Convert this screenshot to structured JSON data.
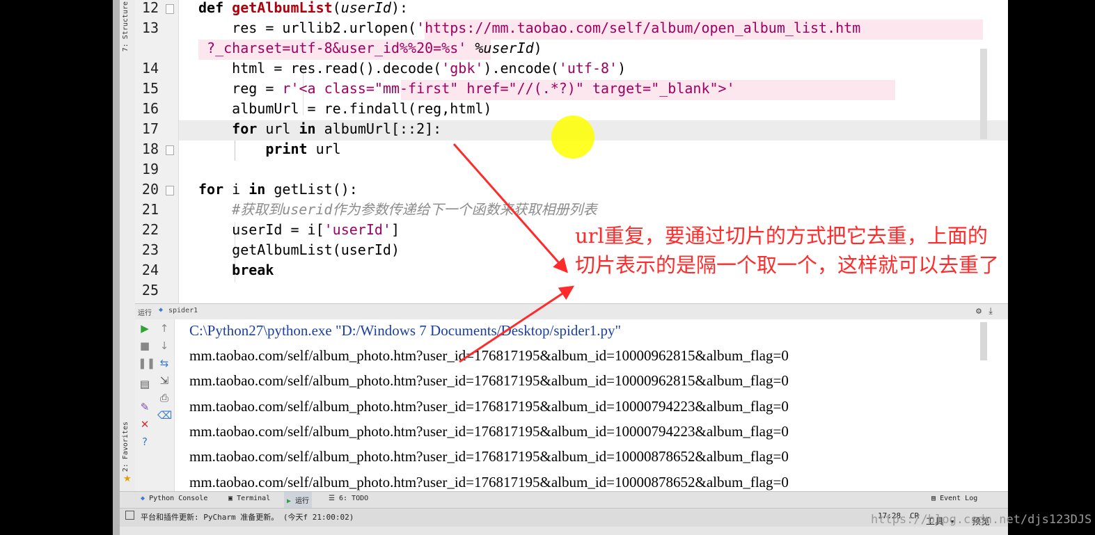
{
  "editor": {
    "lines": [
      {
        "n": "12",
        "parts": [
          {
            "t": "def ",
            "c": "kwb"
          },
          {
            "t": "getAlbumList",
            "c": "fn"
          },
          {
            "t": "("
          },
          {
            "t": "userId",
            "c": "param"
          },
          {
            "t": "):"
          }
        ]
      },
      {
        "n": "13",
        "parts": [
          {
            "t": "    res = urllib2.urlopen("
          },
          {
            "t": "'https://mm.taobao.com/self/album/open_album_list.htm",
            "c": "str"
          }
        ]
      },
      {
        "n": "",
        "parts": [
          {
            "t": " ?_charset=utf-8&user_id%%20=%s'",
            "c": "str"
          },
          {
            "t": " %"
          },
          {
            "t": "userId",
            "c": "param"
          },
          {
            "t": ")"
          }
        ]
      },
      {
        "n": "14",
        "parts": [
          {
            "t": "    html = res.read().decode("
          },
          {
            "t": "'gbk'",
            "c": "str"
          },
          {
            "t": ").encode("
          },
          {
            "t": "'utf-8'",
            "c": "str"
          },
          {
            "t": ")"
          }
        ]
      },
      {
        "n": "15",
        "parts": [
          {
            "t": "    reg = "
          },
          {
            "t": "r'<a class=\"mm-first\" href=\"//(.*?)\" target=\"_blank\">'",
            "c": "str"
          }
        ]
      },
      {
        "n": "16",
        "parts": [
          {
            "t": "    albumUrl = re.findall(reg,html)"
          }
        ]
      },
      {
        "n": "17",
        "parts": [
          {
            "t": "    "
          },
          {
            "t": "for",
            "c": "kwb"
          },
          {
            "t": " url "
          },
          {
            "t": "in",
            "c": "kwb"
          },
          {
            "t": " albumUrl[::2]:"
          }
        ]
      },
      {
        "n": "18",
        "parts": [
          {
            "t": "        "
          },
          {
            "t": "print",
            "c": "kwb"
          },
          {
            "t": " url"
          }
        ]
      },
      {
        "n": "19",
        "parts": []
      },
      {
        "n": "20",
        "parts": [
          {
            "t": "for",
            "c": "kwb"
          },
          {
            "t": " i "
          },
          {
            "t": "in",
            "c": "kwb"
          },
          {
            "t": " getList():"
          }
        ]
      },
      {
        "n": "21",
        "parts": [
          {
            "t": "    #获取到userid作为参数传递给下一个函数来获取相册列表",
            "c": "cmt"
          }
        ]
      },
      {
        "n": "22",
        "parts": [
          {
            "t": "    userId = i["
          },
          {
            "t": "'userId'",
            "c": "str"
          },
          {
            "t": "]"
          }
        ]
      },
      {
        "n": "23",
        "parts": [
          {
            "t": "    getAlbumList(userId)"
          }
        ]
      },
      {
        "n": "24",
        "parts": [
          {
            "t": "    "
          },
          {
            "t": "break",
            "c": "kwb"
          }
        ]
      },
      {
        "n": "25",
        "parts": []
      }
    ]
  },
  "toolwindow_tabs": {
    "structure": "7: Structure",
    "favorites": "2: Favorites"
  },
  "run": {
    "header_label": "运行",
    "config_name": "spider1",
    "command": "C:\\Python27\\python.exe \"D:/Windows 7 Documents/Desktop/spider1.py\"",
    "output": [
      "mm.taobao.com/self/album_photo.htm?user_id=176817195&album_id=10000962815&album_flag=0",
      "mm.taobao.com/self/album_photo.htm?user_id=176817195&album_id=10000962815&album_flag=0",
      "mm.taobao.com/self/album_photo.htm?user_id=176817195&album_id=10000794223&album_flag=0",
      "mm.taobao.com/self/album_photo.htm?user_id=176817195&album_id=10000794223&album_flag=0",
      "mm.taobao.com/self/album_photo.htm?user_id=176817195&album_id=10000878652&album_flag=0",
      "mm.taobao.com/self/album_photo.htm?user_id=176817195&album_id=10000878652&album_flag=0"
    ]
  },
  "bottom_tabs": {
    "python_console": "Python Console",
    "terminal": "Terminal",
    "run": "运行",
    "todo": "6: TODO",
    "event_log": "Event Log"
  },
  "status": {
    "message": "平台和插件更新: PyCharm 准备更新。 (今天f 21:00:02)",
    "position": "17:28",
    "crlf": "CR",
    "tools": "工具",
    "preview": "预览"
  },
  "annotation": {
    "line1": "url重复，要通过切片的方式把它去重，上面的",
    "line2": "切片表示的是隔一个取一个，这样就可以去重了",
    "color": "#ff2a2a"
  },
  "watermark": "https://blog.csdn.net/djs123DJS"
}
